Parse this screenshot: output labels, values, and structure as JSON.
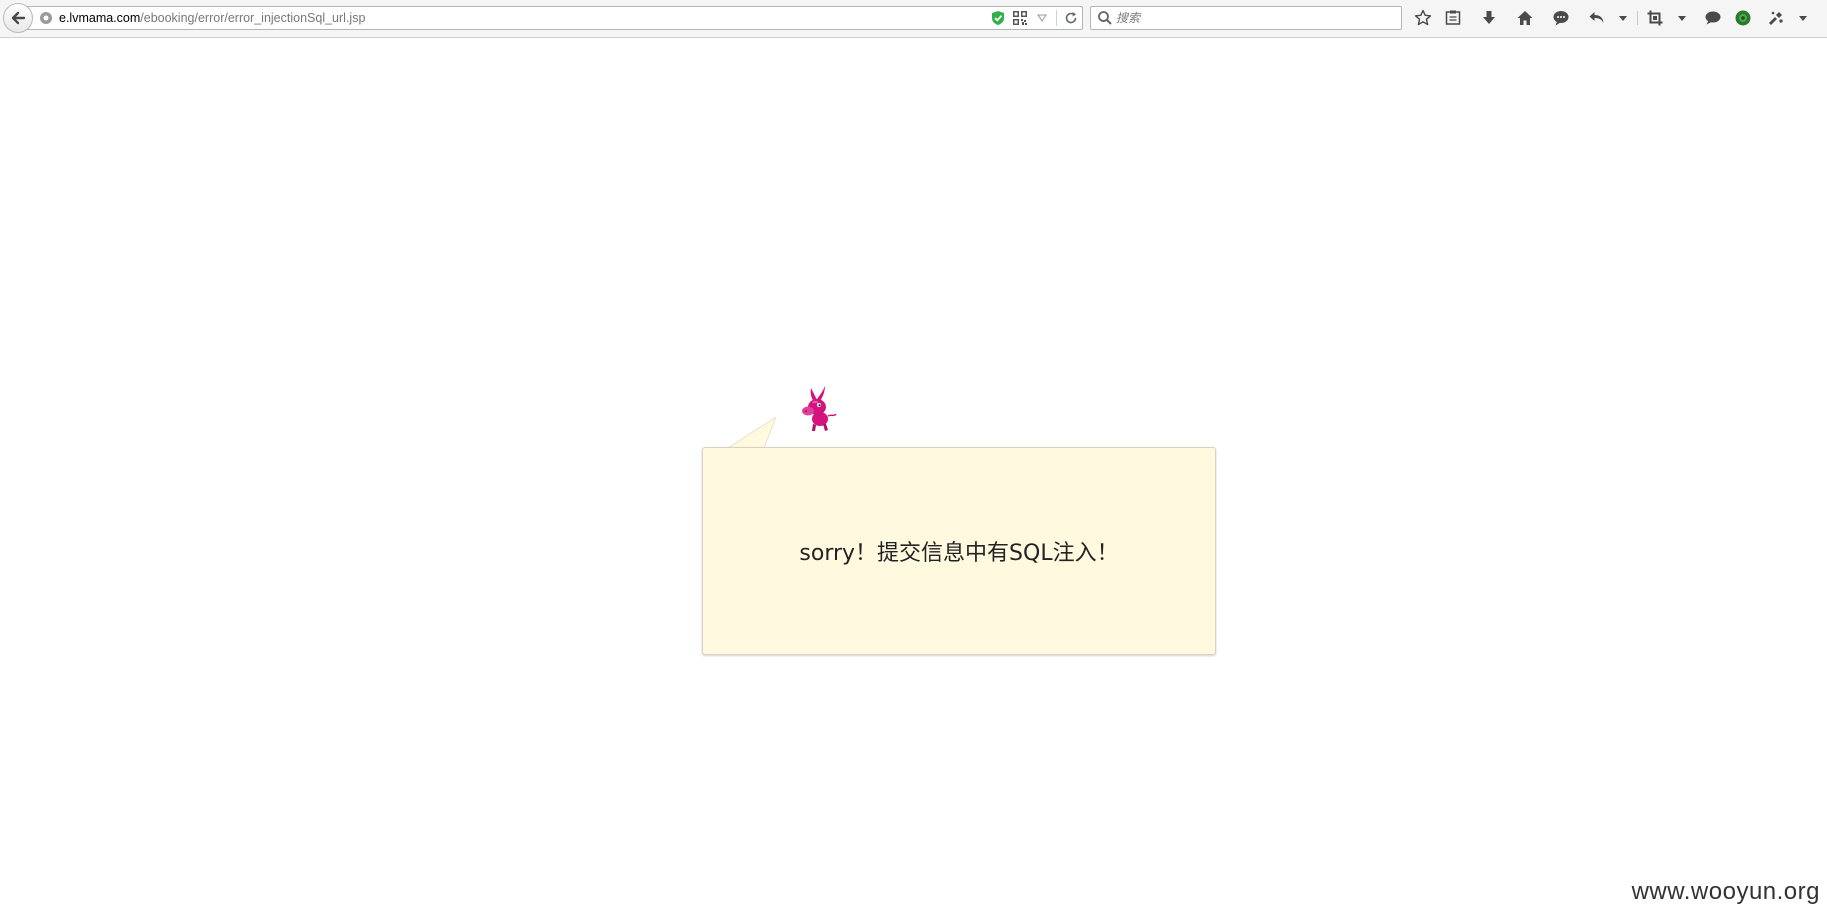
{
  "browser": {
    "url_host": "e.lvmama.com",
    "url_path": "/ebooking/error/error_injectionSql_url.jsp",
    "search_placeholder": "搜索",
    "toolbar_icons": [
      "bookmark-star-icon",
      "reading-list-icon",
      "download-icon",
      "home-icon",
      "chat-icon",
      "undo-icon",
      "crop-icon",
      "speech-bubble-icon",
      "green-circle-icon",
      "extension-icon"
    ]
  },
  "page": {
    "error_message": "sorry！提交信息中有SQL注入！",
    "mascot": "pink-donkey-mascot",
    "accent_color": "#fff9e0",
    "mascot_color": "#d4137e"
  },
  "watermark": {
    "text": "www.wooyun.org"
  }
}
